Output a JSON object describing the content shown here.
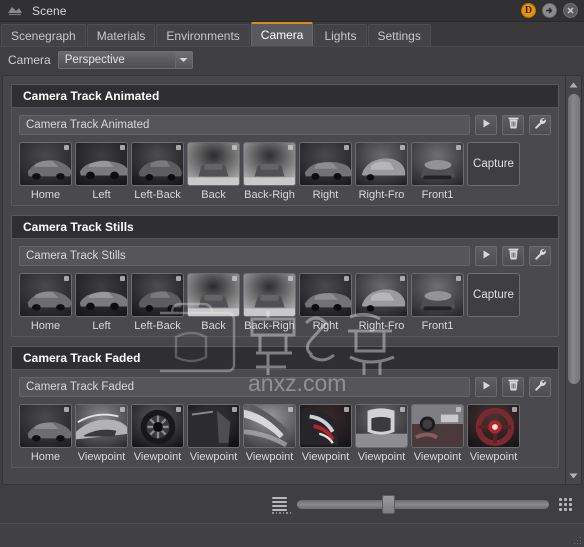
{
  "titlebar": {
    "app_icon": "scene-app-icon",
    "title": "Scene",
    "buttons": [
      {
        "name": "badge-d-button",
        "label": "D"
      },
      {
        "name": "detach-arrow-button",
        "label": ""
      },
      {
        "name": "close-button",
        "label": ""
      }
    ]
  },
  "tabs": [
    {
      "label": "Scenegraph",
      "active": false
    },
    {
      "label": "Materials",
      "active": false
    },
    {
      "label": "Environments",
      "active": false
    },
    {
      "label": "Camera",
      "active": true
    },
    {
      "label": "Lights",
      "active": false
    },
    {
      "label": "Settings",
      "active": false
    }
  ],
  "camera_row": {
    "label": "Camera",
    "selected": "Perspective",
    "options": [
      "Perspective"
    ]
  },
  "panels": [
    {
      "title": "Camera Track Animated",
      "field_value": "Camera Track Animated",
      "field_placeholder": "Camera Track Animated",
      "actions": [
        {
          "name": "play-button",
          "icon": "play-icon"
        },
        {
          "name": "delete-button",
          "icon": "trash-icon"
        },
        {
          "name": "settings-button",
          "icon": "wrench-icon"
        }
      ],
      "thumbs": [
        {
          "label": "Home",
          "shot": "car-three-quarter-front"
        },
        {
          "label": "Left",
          "shot": "car-side-left"
        },
        {
          "label": "Left-Back",
          "shot": "car-rear-left"
        },
        {
          "label": "Back",
          "shot": "car-rear"
        },
        {
          "label": "Back-Righ",
          "shot": "car-rear-right"
        },
        {
          "label": "Right",
          "shot": "car-side-right"
        },
        {
          "label": "Right-Fro",
          "shot": "car-front-right"
        },
        {
          "label": "Front1",
          "shot": "car-front"
        }
      ],
      "capture_label": "Capture"
    },
    {
      "title": "Camera Track Stills",
      "field_value": "Camera Track Stills",
      "field_placeholder": "Camera Track Stills",
      "actions": [
        {
          "name": "play-button",
          "icon": "play-icon"
        },
        {
          "name": "delete-button",
          "icon": "trash-icon"
        },
        {
          "name": "settings-button",
          "icon": "wrench-icon"
        }
      ],
      "thumbs": [
        {
          "label": "Home",
          "shot": "car-three-quarter-front"
        },
        {
          "label": "Left",
          "shot": "car-side-left"
        },
        {
          "label": "Left-Back",
          "shot": "car-rear-left"
        },
        {
          "label": "Back",
          "shot": "car-rear"
        },
        {
          "label": "Back-Righ",
          "shot": "car-rear-right"
        },
        {
          "label": "Right",
          "shot": "car-side-right"
        },
        {
          "label": "Right-Fro",
          "shot": "car-front-right"
        },
        {
          "label": "Front1",
          "shot": "car-front"
        }
      ],
      "capture_label": "Capture"
    },
    {
      "title": "Camera Track Faded",
      "field_value": "Camera Track Faded",
      "field_placeholder": "Camera Track Faded",
      "actions": [
        {
          "name": "play-button",
          "icon": "play-icon"
        },
        {
          "name": "delete-button",
          "icon": "trash-icon"
        },
        {
          "name": "settings-button",
          "icon": "wrench-icon"
        }
      ],
      "thumbs": [
        {
          "label": "Home",
          "shot": "car-three-quarter-front"
        },
        {
          "label": "Viewpoint",
          "shot": "car-hood-detail"
        },
        {
          "label": "Viewpoint",
          "shot": "car-wheel-detail"
        },
        {
          "label": "Viewpoint",
          "shot": "car-door-detail"
        },
        {
          "label": "Viewpoint",
          "shot": "car-body-light"
        },
        {
          "label": "Viewpoint",
          "shot": "car-tail-red"
        },
        {
          "label": "Viewpoint",
          "shot": "car-seat-interior"
        },
        {
          "label": "Viewpoint",
          "shot": "car-dashboard"
        },
        {
          "label": "Viewpoint",
          "shot": "car-steering-wheel"
        }
      ],
      "capture_label": ""
    }
  ],
  "scrollbar": {
    "up_icon": "chevron-up-icon",
    "down_icon": "chevron-down-icon"
  },
  "bottombar": {
    "list_view_icon": "list-view-icon",
    "grid_view_icon": "grid-view-icon",
    "slider_value": 34
  },
  "watermark": {
    "text": "anxz.com",
    "cjk": "装机之家"
  },
  "colors": {
    "accent": "#e08a1e",
    "window_bg": "#3f3f42",
    "panel_bg": "#4a4a4e",
    "panel_header": "#2f2f32",
    "scroll_bg": "#47474a",
    "title_bg": "#313134",
    "text": "#d6d6d6"
  }
}
